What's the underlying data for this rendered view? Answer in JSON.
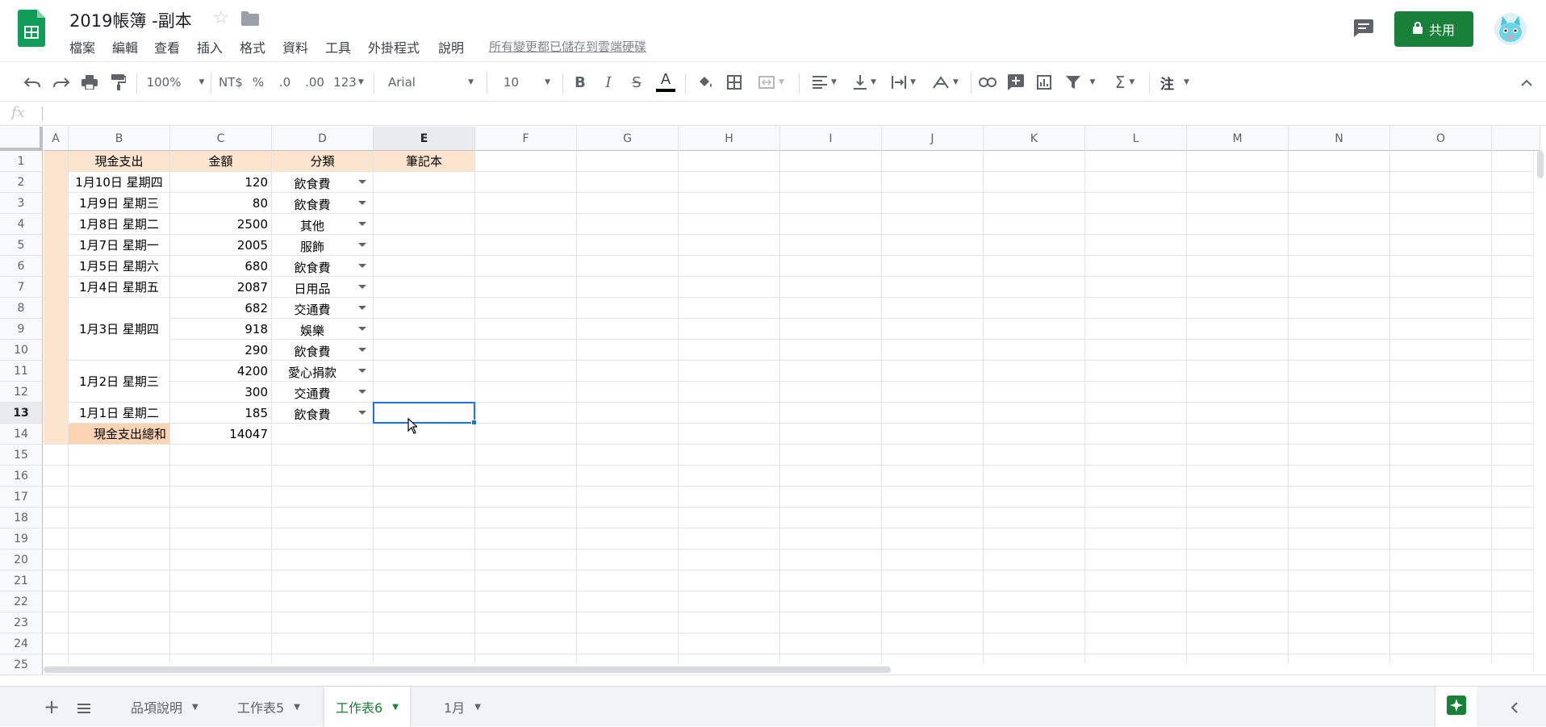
{
  "doc": {
    "title": "2019帳簿 -副本",
    "save_status": "所有變更都已儲存到雲端硬碟",
    "share_label": "共用"
  },
  "menu": [
    "檔案",
    "編輯",
    "查看",
    "插入",
    "格式",
    "資料",
    "工具",
    "外掛程式",
    "說明"
  ],
  "toolbar": {
    "zoom": "100%",
    "currency": "NT$",
    "percent": "%",
    "dec_decrease": ".0",
    "dec_increase": ".00",
    "more_formats": "123",
    "font": "Arial",
    "font_size": "10",
    "bold": "B",
    "italic": "I",
    "strike": "S",
    "text_color": "A",
    "comment_label": "注"
  },
  "formula_bar": {
    "fx": "fx",
    "value": ""
  },
  "columns": [
    "A",
    "B",
    "C",
    "D",
    "E",
    "F",
    "G",
    "H",
    "I",
    "J",
    "K",
    "L",
    "M",
    "N",
    "O"
  ],
  "rows": [
    "1",
    "2",
    "3",
    "4",
    "5",
    "6",
    "7",
    "8",
    "9",
    "10",
    "11",
    "12",
    "13",
    "14",
    "15",
    "16",
    "17",
    "18",
    "19",
    "20",
    "21",
    "22",
    "23",
    "24",
    "25"
  ],
  "headers": {
    "b": "現金支出",
    "c": "金額",
    "d": "分類",
    "e": "筆記本"
  },
  "dates": [
    "1月10日 星期四",
    "1月9日 星期三",
    "1月8日 星期二",
    "1月7日 星期一",
    "1月5日 星期六",
    "1月4日 星期五",
    "1月3日 星期四",
    "1月2日 星期三",
    "1月1日 星期二"
  ],
  "amounts": [
    "120",
    "80",
    "2500",
    "2005",
    "680",
    "2087",
    "682",
    "918",
    "290",
    "4200",
    "300",
    "185"
  ],
  "categories": [
    "飲食費",
    "飲食費",
    "其他",
    "服飾",
    "飲食費",
    "日用品",
    "交通費",
    "娛樂",
    "飲食費",
    "愛心捐款",
    "交通費",
    "飲食費"
  ],
  "total": {
    "label": "現金支出總和",
    "value": "14047"
  },
  "sheets": [
    "品項說明",
    "工作表5",
    "工作表6",
    "1月"
  ],
  "active_sheet": "工作表6",
  "colors": {
    "brand_green": "#188038",
    "header_peach": "#fde4cf",
    "total_peach": "#fbd4b4",
    "selection_blue": "#1a73e8"
  }
}
